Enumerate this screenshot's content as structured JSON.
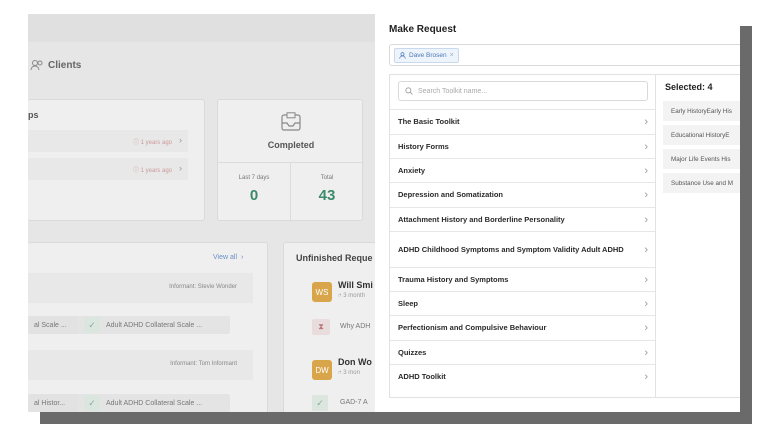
{
  "background": {
    "nav": {
      "clients_label": "Clients"
    },
    "top_card": {
      "title": "ps",
      "rows": [
        {
          "time": "ⓘ 1 years ago"
        },
        {
          "time": "ⓘ 1 years ago"
        }
      ]
    },
    "completed_card": {
      "title": "Completed",
      "last7_label": "Last 7 days",
      "last7_value": "0",
      "total_label": "Total",
      "total_value": "43"
    },
    "view_all": "View all",
    "unfinished_title": "Unfinished Reque",
    "informant1": "Informant: Stevie Wonder",
    "informant2": "Informant: Tom Informant",
    "pill_left1": "al Scale ...",
    "pill_right1": "Adult ADHD Collateral Scale ...",
    "pill_left2": "al Histor...",
    "pill_right2": "Adult ADHD Collateral Scale ...",
    "person1": {
      "initials": "WS",
      "name": "Will Smi",
      "meta": "⑁ 3 month"
    },
    "person1_item": "Why ADH",
    "person2": {
      "initials": "DW",
      "name": "Don Wo",
      "meta": "⑁ 3 mon"
    },
    "person2_item": "GAD-7 A"
  },
  "modal": {
    "title": "Make Request",
    "chip_label": "Dave Brosen",
    "chip_close": "×",
    "search_placeholder": "Search Toolkit name...",
    "toolkits": [
      "The Basic Toolkit",
      "History Forms",
      "Anxiety",
      "Depression and Somatization",
      "Attachment History and Borderline Personality",
      "ADHD Childhood Symptoms and Symptom Validity Adult ADHD",
      "Trauma History and Symptoms",
      "Sleep",
      "Perfectionism and Compulsive Behaviour",
      "Quizzes",
      "ADHD Toolkit"
    ],
    "chevron": "›",
    "selected_title": "Selected: 4",
    "selected_items": [
      "Early HistoryEarly His",
      "Educational HistoryE",
      "Major Life Events His",
      "Substance Use and M"
    ]
  },
  "colors": {
    "accent_green": "#3d8a6a",
    "chip_blue": "#4a78b8",
    "avatar_orange": "#d9a54a"
  }
}
